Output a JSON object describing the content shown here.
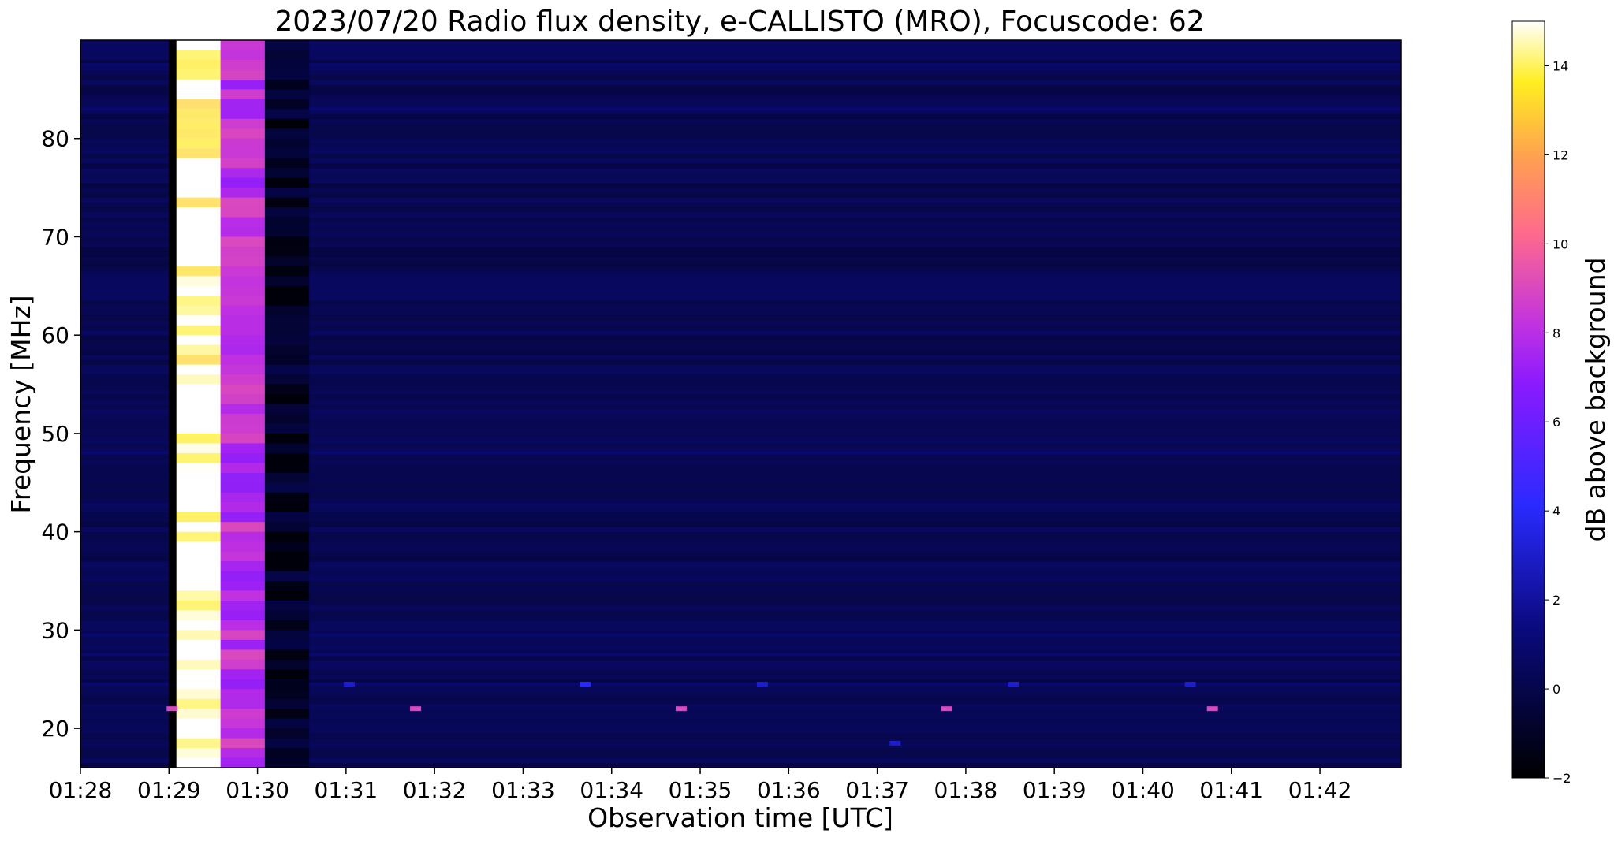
{
  "chart_data": {
    "type": "heatmap",
    "title": "2023/07/20  Radio flux density, e-CALLISTO (MRO), Focuscode: 62",
    "xlabel": "Observation time [UTC]",
    "ylabel": "Frequency [MHz]",
    "colorbar_label": "dB above background",
    "colormap": "gnuplot2",
    "x_range": [
      "01:28:00",
      "01:42:55"
    ],
    "ylim": [
      16,
      90
    ],
    "clim": [
      -2,
      15
    ],
    "x_ticks": [
      "01:28",
      "01:29",
      "01:30",
      "01:31",
      "01:32",
      "01:33",
      "01:34",
      "01:35",
      "01:36",
      "01:37",
      "01:38",
      "01:39",
      "01:40",
      "01:41",
      "01:42"
    ],
    "y_ticks": [
      20,
      30,
      40,
      50,
      60,
      70,
      80
    ],
    "colorbar_ticks": [
      -2,
      0,
      2,
      4,
      6,
      8,
      10,
      12,
      14
    ],
    "background_level_db": 0,
    "features": {
      "calibration_columns": [
        {
          "start": "01:29:05",
          "end": "01:29:35",
          "level_db": 15
        },
        {
          "start": "01:29:35",
          "end": "01:30:05",
          "level_db": 8
        },
        {
          "start": "01:30:05",
          "end": "01:30:35",
          "level_db": -1
        }
      ],
      "horizontal_bands_mhz": [
        87.5,
        83,
        48,
        29.5,
        27.5,
        24.5
      ],
      "drift_bursts": [
        {
          "time": "01:31:00",
          "freq_mhz": 24.5,
          "level_db": 3
        },
        {
          "time": "01:33:40",
          "freq_mhz": 24.5,
          "level_db": 4
        },
        {
          "time": "01:35:40",
          "freq_mhz": 24.5,
          "level_db": 3
        },
        {
          "time": "01:37:10",
          "freq_mhz": 18.5,
          "level_db": 3
        },
        {
          "time": "01:38:30",
          "freq_mhz": 24.5,
          "level_db": 3
        },
        {
          "time": "01:40:30",
          "freq_mhz": 24.5,
          "level_db": 3
        },
        {
          "time": "01:29:00",
          "freq_mhz": 22,
          "level_db": 9
        },
        {
          "time": "01:31:45",
          "freq_mhz": 22,
          "level_db": 9
        },
        {
          "time": "01:34:45",
          "freq_mhz": 22,
          "level_db": 9
        },
        {
          "time": "01:37:45",
          "freq_mhz": 22,
          "level_db": 9
        },
        {
          "time": "01:40:45",
          "freq_mhz": 22,
          "level_db": 9
        }
      ]
    }
  }
}
